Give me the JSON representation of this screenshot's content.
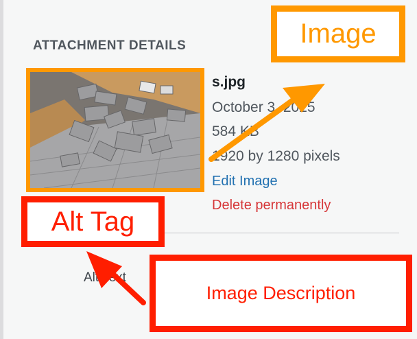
{
  "section": {
    "heading": "ATTACHMENT DETAILS"
  },
  "attachment": {
    "filename": "s.jpg",
    "date": "October 3, 2025",
    "size": "584 KB",
    "dimensions": "1920 by 1280 pixels",
    "edit_link": "Edit Image",
    "delete_link": "Delete permanently"
  },
  "field": {
    "alt_text_label": "Alt Text"
  },
  "annotations": {
    "image": "Image",
    "alt_tag": "Alt Tag",
    "image_description": "Image Description"
  },
  "colors": {
    "orange_annotation": "#ff9800",
    "red_annotation": "#ff1e00",
    "link_blue": "#2271b1",
    "delete_red": "#d63638"
  },
  "icons": {
    "orange_arrow": "arrow-up-right-icon",
    "red_arrow": "arrow-up-left-icon"
  }
}
